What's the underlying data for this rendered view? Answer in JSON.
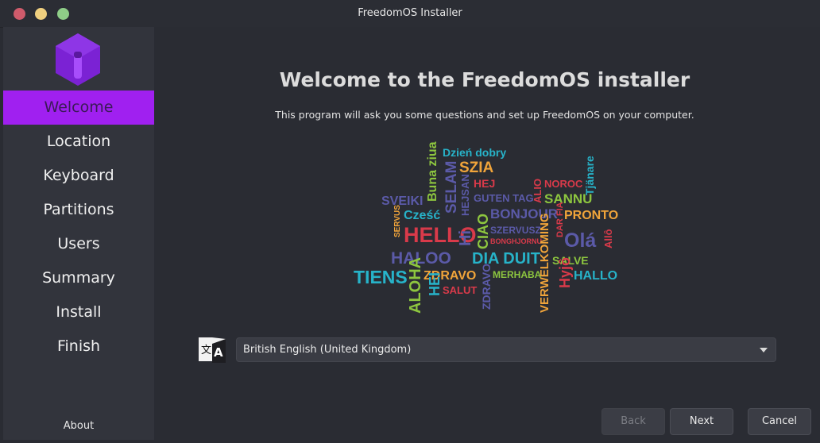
{
  "window": {
    "title": "FreedomOS Installer"
  },
  "sidebar": {
    "items": [
      {
        "label": "Welcome",
        "active": true
      },
      {
        "label": "Location"
      },
      {
        "label": "Keyboard"
      },
      {
        "label": "Partitions"
      },
      {
        "label": "Users"
      },
      {
        "label": "Summary"
      },
      {
        "label": "Install"
      },
      {
        "label": "Finish"
      }
    ],
    "about_label": "About"
  },
  "main": {
    "heading": "Welcome to the FreedomOS installer",
    "subtext": "This program will ask you some questions and set up FreedomOS on your computer.",
    "language_select": {
      "value": "British English (United Kingdom)",
      "icon": "translate-icon"
    }
  },
  "word_cloud": {
    "words": [
      "Buna ziua",
      "Dzień dobry",
      "SZIA",
      "SELAM",
      "Tjänare",
      "HEJ",
      "NOROC",
      "SVEIKI",
      "HEJSAN",
      "GUTEN TAG",
      "ALIO",
      "SANNU",
      "Cześć",
      "SERVUS",
      "BONJOUR",
      "DAR FIA",
      "PRONTO",
      "HELLO",
      "Hi",
      "CIAO",
      "SZERVUSZ",
      "BONGHJORNU",
      "Olá",
      "Allô",
      "HALOO",
      "DIA DUIT",
      "VERWELKOMING",
      "SALVE",
      "TIENS",
      "ZDRAVO",
      "MERHABA",
      "Hyjô",
      "HALLO",
      "ALOHA",
      "HEI",
      "SALUT",
      "ZDRAVO"
    ]
  },
  "buttons": {
    "back": "Back",
    "next": "Next",
    "cancel": "Cancel"
  },
  "colors": {
    "accent": "#a020f0",
    "window_bg": "#2a2c33",
    "sidebar_bg": "#32343c"
  }
}
